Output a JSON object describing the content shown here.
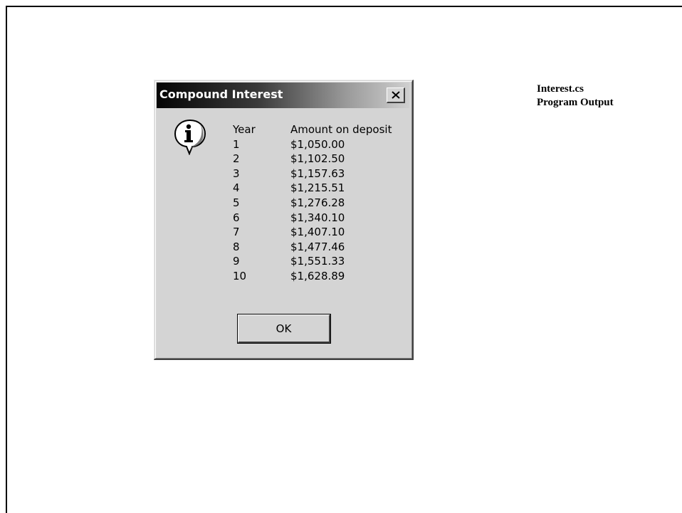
{
  "caption": {
    "line1": "Interest.cs",
    "line2": "Program Output"
  },
  "dialog": {
    "title": "Compound Interest",
    "close_label": "Close",
    "icon": "information-icon",
    "header": {
      "year": "Year",
      "amount": "Amount on deposit"
    },
    "rows": [
      {
        "year": "1",
        "amount": "$1,050.00"
      },
      {
        "year": "2",
        "amount": "$1,102.50"
      },
      {
        "year": "3",
        "amount": "$1,157.63"
      },
      {
        "year": "4",
        "amount": "$1,215.51"
      },
      {
        "year": "5",
        "amount": "$1,276.28"
      },
      {
        "year": "6",
        "amount": "$1,340.10"
      },
      {
        "year": "7",
        "amount": "$1,407.10"
      },
      {
        "year": "8",
        "amount": "$1,477.46"
      },
      {
        "year": "9",
        "amount": "$1,551.33"
      },
      {
        "year": "10",
        "amount": "$1,628.89"
      }
    ],
    "ok_label": "OK"
  }
}
